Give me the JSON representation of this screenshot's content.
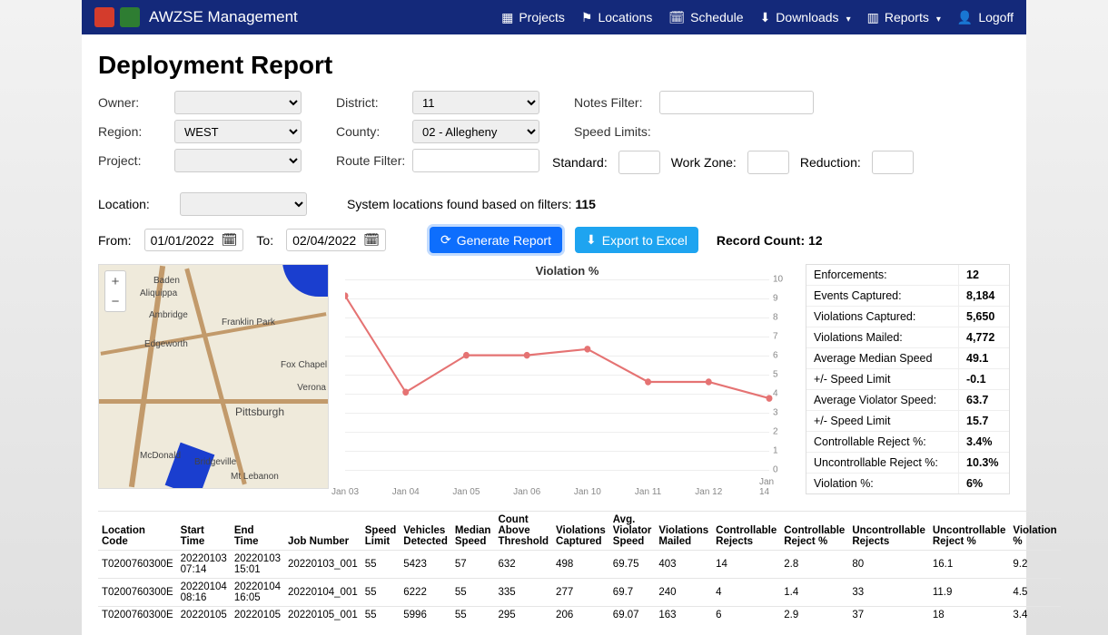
{
  "nav": {
    "brand": "AWZSE Management",
    "items": [
      {
        "label": "Projects",
        "icon": "projects"
      },
      {
        "label": "Locations",
        "icon": "flag"
      },
      {
        "label": "Schedule",
        "icon": "calendar"
      },
      {
        "label": "Downloads",
        "icon": "download",
        "caret": true
      },
      {
        "label": "Reports",
        "icon": "bar",
        "caret": true
      },
      {
        "label": "Logoff",
        "icon": "user"
      }
    ]
  },
  "page_title": "Deployment Report",
  "filters": {
    "owner_label": "Owner:",
    "owner": "",
    "district_label": "District:",
    "district": "11",
    "notes_label": "Notes Filter:",
    "notes": "",
    "region_label": "Region:",
    "region": "WEST",
    "county_label": "County:",
    "county": "02 - Allegheny",
    "speedlimits_label": "Speed Limits:",
    "project_label": "Project:",
    "project": "",
    "route_label": "Route Filter:",
    "route": "",
    "standard_label": "Standard:",
    "standard": "",
    "workzone_label": "Work Zone:",
    "workzone": "",
    "reduction_label": "Reduction:",
    "reduction": "",
    "location_label": "Location:",
    "location": "",
    "locations_found_prefix": "System locations found based on filters: ",
    "locations_found_count": "115",
    "from_label": "From:",
    "from_date": "01/01/2022",
    "to_label": "To:",
    "to_date": "02/04/2022",
    "generate_btn": "Generate Report",
    "export_btn": "Export to Excel",
    "record_count_label": "Record Count: ",
    "record_count": "12"
  },
  "map": {
    "places": [
      "Baden",
      "Aliquippa",
      "Ambridge",
      "Franklin Park",
      "Edgeworth",
      "Fox Chapel",
      "Pittsburgh",
      "Verona",
      "McDonald",
      "Bridgeville",
      "Mt Lebanon"
    ]
  },
  "chart_data": {
    "type": "line",
    "title": "Violation %",
    "categories": [
      "Jan 03",
      "Jan 04",
      "Jan 05",
      "Jan 06",
      "Jan 10",
      "Jan 11",
      "Jan 12",
      "Jan 14"
    ],
    "values": [
      9.2,
      4.5,
      6.3,
      6.3,
      6.6,
      5.0,
      5.0,
      4.2
    ],
    "ylabel": "",
    "xlabel": "",
    "ylim": [
      0,
      10
    ],
    "yticks": [
      0,
      1,
      2,
      3,
      4,
      5,
      6,
      7,
      8,
      9,
      10
    ]
  },
  "stats": [
    {
      "label": "Enforcements:",
      "value": "12"
    },
    {
      "label": "Events Captured:",
      "value": "8,184"
    },
    {
      "label": "Violations Captured:",
      "value": "5,650"
    },
    {
      "label": "Violations Mailed:",
      "value": "4,772"
    },
    {
      "label": "Average Median Speed",
      "value": "49.1"
    },
    {
      "label": "+/- Speed Limit",
      "value": "-0.1"
    },
    {
      "label": "Average Violator Speed:",
      "value": "63.7"
    },
    {
      "label": "+/- Speed Limit",
      "value": "15.7"
    },
    {
      "label": "Controllable Reject %:",
      "value": "3.4%"
    },
    {
      "label": "Uncontrollable Reject %:",
      "value": "10.3%"
    },
    {
      "label": "Violation %:",
      "value": "6%"
    }
  ],
  "table": {
    "columns": [
      "Location Code",
      "Start Time",
      "End Time",
      "Job Number",
      "Speed Limit",
      "Vehicles Detected",
      "Median Speed",
      "Count Above Threshold",
      "Violations Captured",
      "Avg. Violator Speed",
      "Violations Mailed",
      "Controllable Rejects",
      "Controllable Reject %",
      "Uncontrollable Rejects",
      "Uncontrollable Reject %",
      "Violation %"
    ],
    "rows": [
      [
        "T0200760300E",
        "20220103 07:14",
        "20220103 15:01",
        "20220103_001",
        "55",
        "5423",
        "57",
        "632",
        "498",
        "69.75",
        "403",
        "14",
        "2.8",
        "80",
        "16.1",
        "9.2"
      ],
      [
        "T0200760300E",
        "20220104 08:16",
        "20220104 16:05",
        "20220104_001",
        "55",
        "6222",
        "55",
        "335",
        "277",
        "69.7",
        "240",
        "4",
        "1.4",
        "33",
        "11.9",
        "4.5"
      ],
      [
        "T0200760300E",
        "20220105",
        "20220105",
        "20220105_001",
        "55",
        "5996",
        "55",
        "295",
        "206",
        "69.07",
        "163",
        "6",
        "2.9",
        "37",
        "18",
        "3.4"
      ]
    ]
  }
}
